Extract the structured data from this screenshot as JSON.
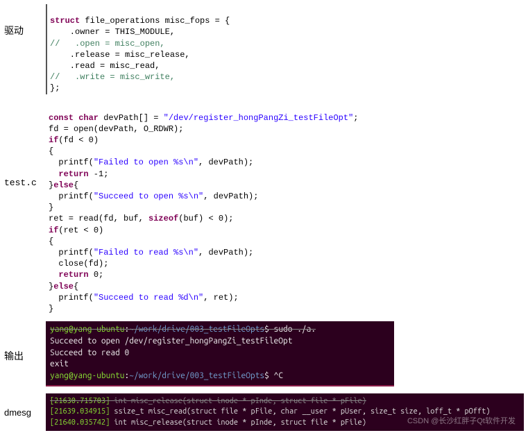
{
  "labels": {
    "driver": "驱动",
    "testc": "test.c",
    "output": "输出",
    "dmesg": "dmesg"
  },
  "driver_code": {
    "l1_kw": "struct",
    "l1_rest": " file_operations misc_fops = {",
    "l2": "    .owner = THIS_MODULE,",
    "l3_com": "//   .open = misc_open,",
    "l4": "    .release = misc_release,",
    "l5": "    .read = misc_read,",
    "l6_com": "//   .write = misc_write,",
    "l7": "};"
  },
  "test_code": {
    "l1_a": "const char",
    "l1_b": " devPath[] = ",
    "l1_str": "\"/dev/register_hongPangZi_testFileOpt\"",
    "l1_c": ";",
    "l2": "fd = open(devPath, O_RDWR);",
    "l3_kw": "if",
    "l3_b": "(fd < ",
    "l3_num": "0",
    "l3_c": ")",
    "l4": "{",
    "l5_a": "  printf(",
    "l5_str": "\"Failed to open %s\\n\"",
    "l5_b": ", devPath);",
    "l6_kw": "  return",
    "l6_b": " -",
    "l6_num": "1",
    "l6_c": ";",
    "l7_a": "}",
    "l7_kw": "else",
    "l7_b": "{",
    "l8_a": "  printf(",
    "l8_str": "\"Succeed to open %s\\n\"",
    "l8_b": ", devPath);",
    "l9": "}",
    "l10_a": "ret = read(fd, buf, ",
    "l10_kw": "sizeof",
    "l10_b": "(buf) < ",
    "l10_num": "0",
    "l10_c": ");",
    "l11_kw": "if",
    "l11_b": "(ret < ",
    "l11_num": "0",
    "l11_c": ")",
    "l12": "{",
    "l13_a": "  printf(",
    "l13_str": "\"Failed to read %s\\n\"",
    "l13_b": ", devPath);",
    "l14": "  close(fd);",
    "l15_kw": "  return",
    "l15_b": " ",
    "l15_num": "0",
    "l15_c": ";",
    "l16_a": "}",
    "l16_kw": "else",
    "l16_b": "{",
    "l17_a": "  printf(",
    "l17_str": "\"Succeed to read %d\\n\"",
    "l17_b": ", ret);",
    "l18": "}"
  },
  "terminal": {
    "l1_a": "yang@yang-ubuntu",
    "l1_b": ":",
    "l1_c": "~/work/drive/003_testFileOpts",
    "l1_d": "$ sudo ./a.",
    "l2": "Succeed to open /dev/register_hongPangZi_testFileOpt",
    "l3": "Succeed to read 0",
    "l4": "exit",
    "l5_a": "yang@yang-ubuntu",
    "l5_b": ":",
    "l5_c": "~/work/drive/003_testFileOpts",
    "l5_d": "$ ^C"
  },
  "dmesg": {
    "l1_ts": "[21630.715703]",
    "l1_txt": " int misc_release(struct inode * pInde, struct file * pFile)",
    "l2_ts": "[21639.034915]",
    "l2_txt": " ssize_t misc_read(struct file * pFile, char __user * pUser, size_t size, loff_t * pOfft)",
    "l3_ts": "[21640.035742]",
    "l3_txt": " int misc_release(struct inode * pInde, struct file * pFile)"
  },
  "watermark": "CSDN @长沙红胖子Qt软件开发"
}
